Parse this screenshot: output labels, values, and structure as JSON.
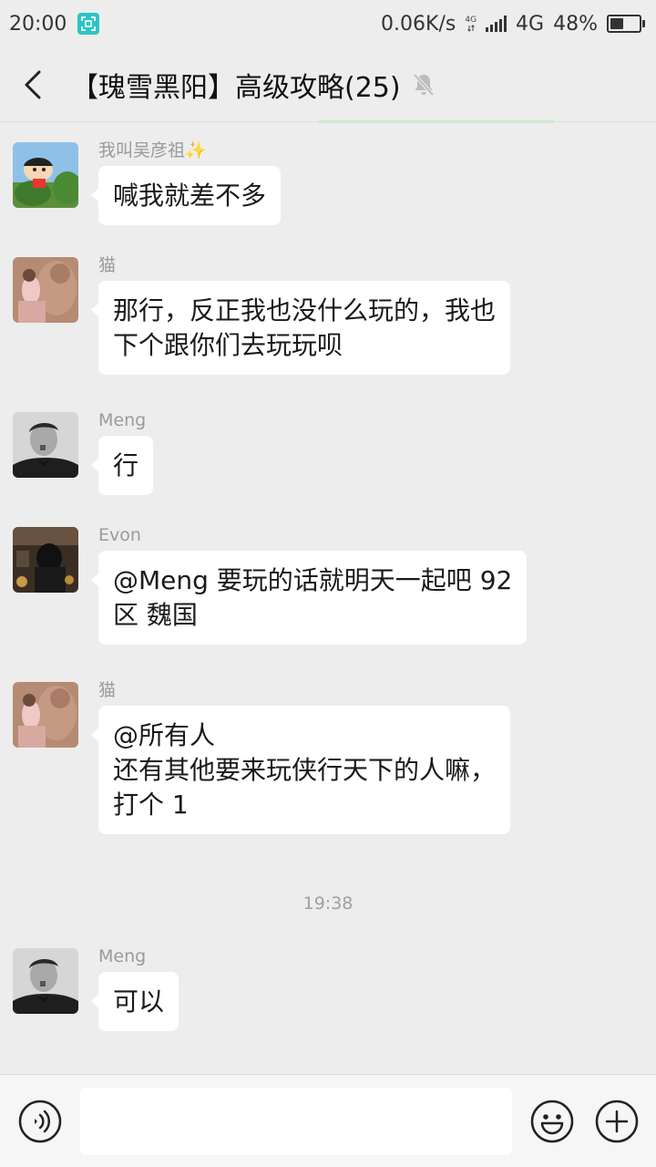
{
  "status_bar": {
    "time": "20:00",
    "net_speed": "0.06K/s",
    "small_4g": "4G",
    "network": "4G",
    "battery_pct": "48%",
    "battery_level": 0.48
  },
  "header": {
    "title": "【瑰雪黑阳】高级攻略(25)"
  },
  "messages": [
    {
      "sender": "我叫吴彦祖✨",
      "text": "喊我就差不多"
    },
    {
      "sender": "猫",
      "text": "那行，反正我也没什么玩的，我也\n下个跟你们去玩玩呗"
    },
    {
      "sender": "Meng",
      "text": "行"
    },
    {
      "sender": "Evon",
      "text": "@Meng 要玩的话就明天一起吧 92\n区 魏国"
    },
    {
      "sender": "猫",
      "text": "@所有人\n还有其他要来玩侠行天下的人嘛，\n打个 1"
    },
    {
      "sender": "Meng",
      "text": "可以"
    }
  ],
  "time_separator": "19:38",
  "input": {
    "value": "",
    "placeholder": ""
  },
  "icons": {
    "back": "back-arrow-icon",
    "mute": "bell-muted-icon",
    "voice": "voice-icon",
    "emoji": "emoji-icon",
    "plus": "plus-icon"
  },
  "colors": {
    "background": "#ededed",
    "bubble": "#ffffff",
    "sender_text": "#9a9a9a",
    "scan_badge": "#2ec4c4"
  }
}
